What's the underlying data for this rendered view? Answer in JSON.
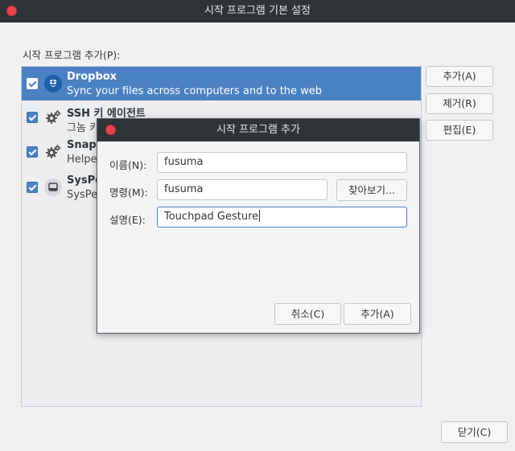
{
  "window": {
    "title": "시작 프로그램 기본 설정"
  },
  "list": {
    "label": "시작 프로그램 추가(P):",
    "items": [
      {
        "name": "Dropbox",
        "description": "Sync your files across computers and to the web",
        "checked": true,
        "selected": true,
        "icon": "dropbox-icon"
      },
      {
        "name": "SSH 키 에이전트",
        "description": "그놈 키",
        "checked": true,
        "selected": false,
        "icon": "gear-icon"
      },
      {
        "name": "Snap",
        "description": "Helper",
        "checked": true,
        "selected": false,
        "icon": "gear-icon"
      },
      {
        "name": "SysPee",
        "description": "SysPee",
        "checked": true,
        "selected": false,
        "icon": "drive-icon"
      }
    ]
  },
  "buttons": {
    "add": "추가(A)",
    "remove": "제거(R)",
    "edit": "편집(E)",
    "close": "닫기(C)"
  },
  "dialog": {
    "title": "시작 프로그램 추가",
    "name_label": "이름(N):",
    "name_value": "fusuma",
    "command_label": "명령(M):",
    "command_value": "fusuma",
    "browse": "찾아보기...",
    "comment_label": "설명(E):",
    "comment_value": "Touchpad Gesture",
    "cancel": "취소(C)",
    "add": "추가(A)"
  },
  "colors": {
    "selection": "#4a81c2",
    "titlebar": "#2f3237",
    "close": "#e8424a"
  }
}
